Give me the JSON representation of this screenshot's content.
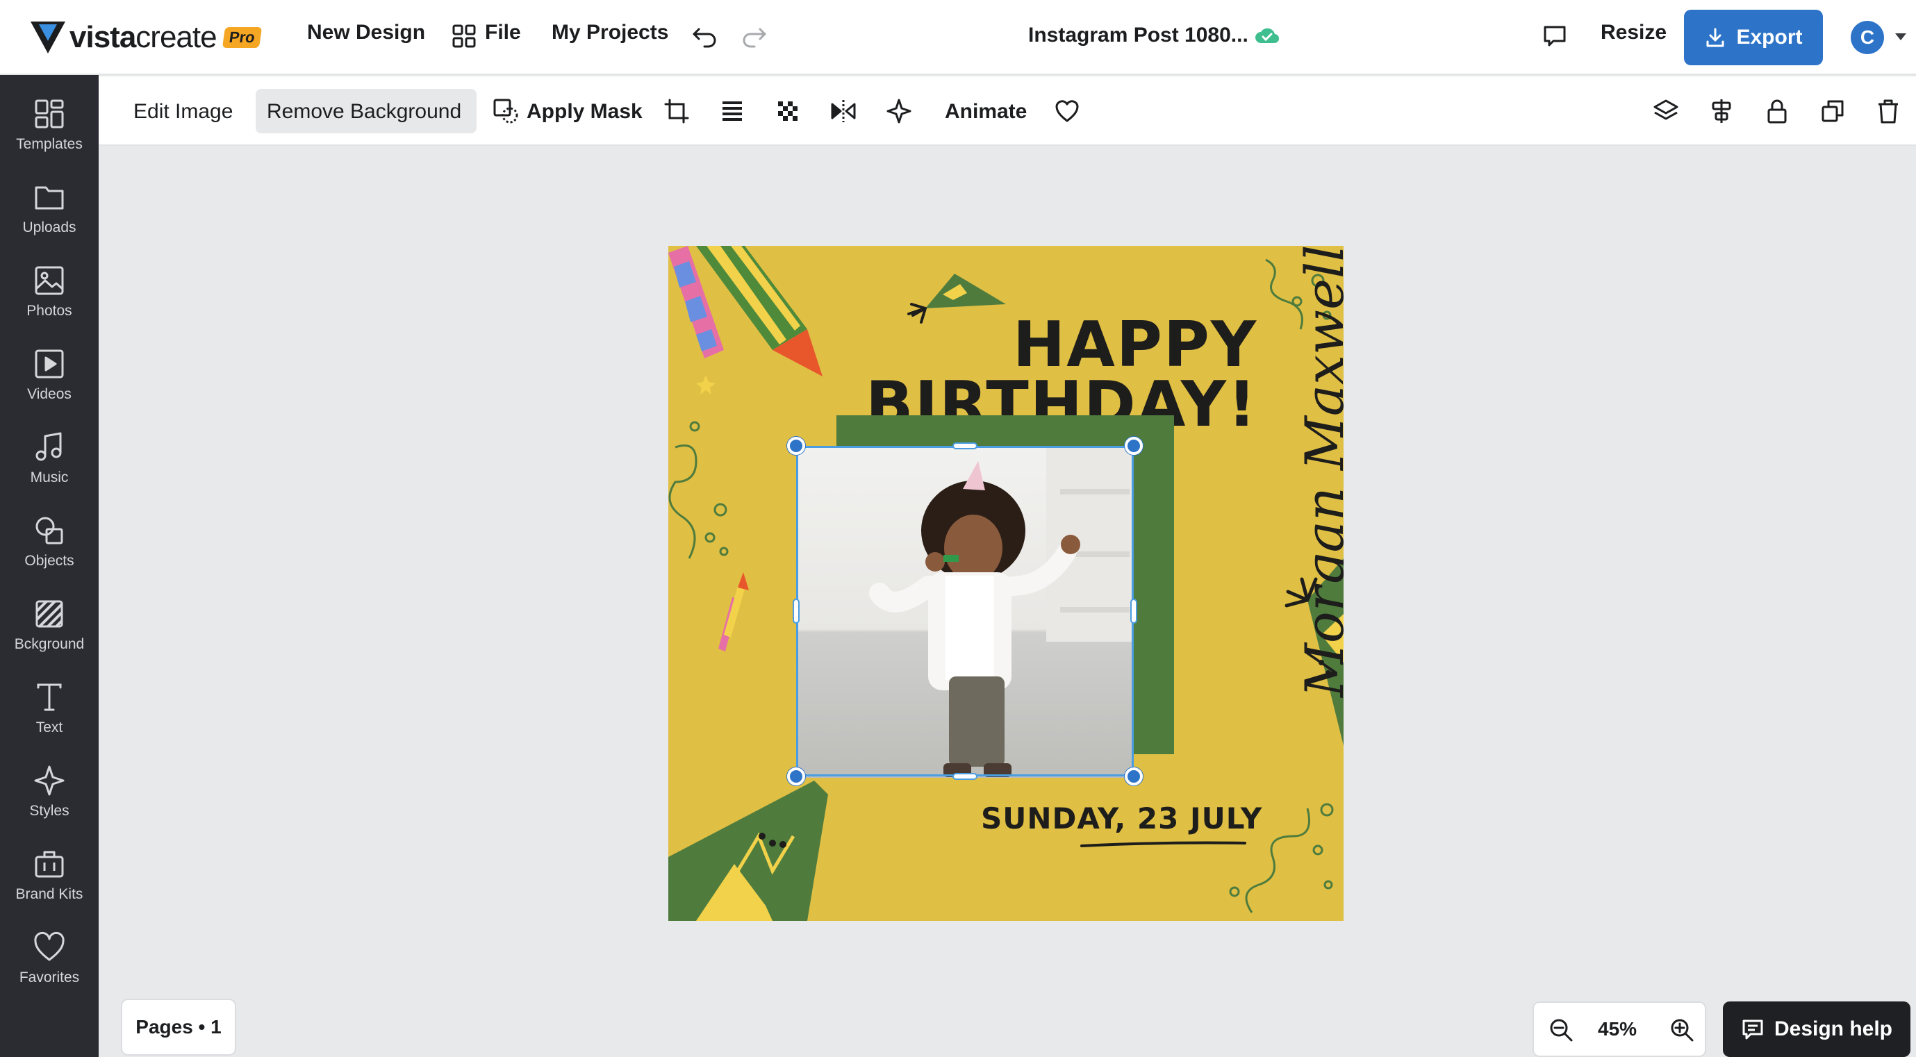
{
  "topbar": {
    "logo_text": "vistacreate",
    "pro_badge": "Pro",
    "new_design": "New Design",
    "file": "File",
    "my_projects": "My Projects",
    "document_title": "Instagram Post 1080...",
    "resize": "Resize",
    "export": "Export",
    "avatar_initial": "C"
  },
  "sidebar": {
    "items": [
      {
        "label": "Templates",
        "icon": "templates-icon"
      },
      {
        "label": "Uploads",
        "icon": "folder-icon"
      },
      {
        "label": "Photos",
        "icon": "image-icon"
      },
      {
        "label": "Videos",
        "icon": "play-icon"
      },
      {
        "label": "Music",
        "icon": "music-note-icon"
      },
      {
        "label": "Objects",
        "icon": "shapes-icon"
      },
      {
        "label": "Bckground",
        "icon": "stripes-icon"
      },
      {
        "label": "Text",
        "icon": "text-icon"
      },
      {
        "label": "Styles",
        "icon": "sparkle-icon"
      },
      {
        "label": "Brand Kits",
        "icon": "briefcase-icon"
      },
      {
        "label": "Favorites",
        "icon": "heart-icon"
      }
    ]
  },
  "toolbar": {
    "edit_image": "Edit Image",
    "remove_background": "Remove Background",
    "apply_mask": "Apply Mask",
    "animate": "Animate"
  },
  "canvas": {
    "headline_line1": "HAPPY",
    "headline_line2": "BIRTHDAY!",
    "name": "Morgan Maxwell",
    "date": "SUNDAY, 23 JULY",
    "background_color": "#e0bf45",
    "accent_green": "#4f7c3d"
  },
  "bottom": {
    "pages": "Pages • 1",
    "zoom": "45%",
    "design_help": "Design help"
  },
  "colors": {
    "accent_blue": "#2d74c9",
    "sidebar_bg": "#2b2c31",
    "pro_orange": "#f5a623"
  }
}
